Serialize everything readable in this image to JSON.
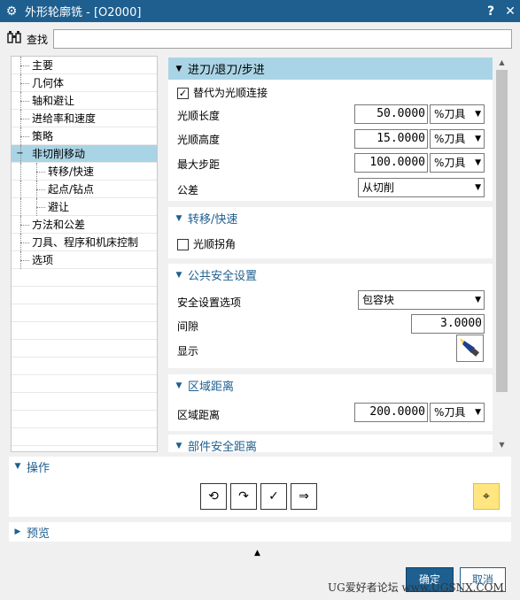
{
  "window": {
    "title": "外形轮廓铣 - [O2000]",
    "help_label": "?",
    "close_label": "✕",
    "gear_icon": "⚙"
  },
  "find": {
    "label": "查找",
    "icon": "binoculars-icon",
    "value": ""
  },
  "tree": {
    "items": [
      {
        "label": "主要",
        "level": 0
      },
      {
        "label": "几何体",
        "level": 0
      },
      {
        "label": "轴和避让",
        "level": 0
      },
      {
        "label": "进给率和速度",
        "level": 0
      },
      {
        "label": "策略",
        "level": 0
      },
      {
        "label": "非切削移动",
        "level": 0,
        "selected": true,
        "expanded": true
      },
      {
        "label": "转移/快速",
        "level": 1
      },
      {
        "label": "起点/钻点",
        "level": 1
      },
      {
        "label": "避让",
        "level": 1
      },
      {
        "label": "方法和公差",
        "level": 0
      },
      {
        "label": "刀具、程序和机床控制",
        "level": 0
      },
      {
        "label": "选项",
        "level": 0
      }
    ],
    "expand_glyph": "−"
  },
  "sections": {
    "engage": {
      "title": "进刀/退刀/步进",
      "replace_smooth": {
        "label": "替代为光顺连接",
        "checked": true,
        "check_glyph": "✓"
      },
      "smooth_length": {
        "label": "光顺长度",
        "value": "50.0000",
        "unit": "%刀具"
      },
      "smooth_height": {
        "label": "光顺高度",
        "value": "15.0000",
        "unit": "%刀具"
      },
      "max_step": {
        "label": "最大步距",
        "value": "100.0000",
        "unit": "%刀具"
      },
      "tolerance": {
        "label": "公差",
        "value": "从切削"
      }
    },
    "transfer": {
      "title": "转移/快速",
      "smooth_corner": {
        "label": "光顺拐角",
        "checked": false
      }
    },
    "safety": {
      "title": "公共安全设置",
      "option": {
        "label": "安全设置选项",
        "value": "包容块"
      },
      "clearance": {
        "label": "间隙",
        "value": "3.0000"
      },
      "display": {
        "label": "显示",
        "icon": "flashlight-icon"
      }
    },
    "region": {
      "title": "区域距离",
      "distance": {
        "label": "区域距离",
        "value": "200.0000",
        "unit": "%刀具"
      }
    },
    "part_safety": {
      "title": "部件安全距离"
    }
  },
  "operations": {
    "title": "操作",
    "buttons": [
      {
        "name": "generate-icon",
        "glyph": "⟲"
      },
      {
        "name": "replay-icon",
        "glyph": "↷"
      },
      {
        "name": "confirm-icon",
        "glyph": "✓"
      },
      {
        "name": "list-icon",
        "glyph": "⇒"
      },
      {
        "name": "highlight-icon",
        "glyph": "⌖"
      }
    ]
  },
  "preview": {
    "title": "预览"
  },
  "collapse_glyph": "▲",
  "tri_down": "▼",
  "tri_right": "▶",
  "dropdown_glyph": "▼",
  "footer": {
    "ok_label": "确定",
    "cancel_label": "取消"
  },
  "watermark": "UG爱好者论坛 www.UGSNX.COM"
}
